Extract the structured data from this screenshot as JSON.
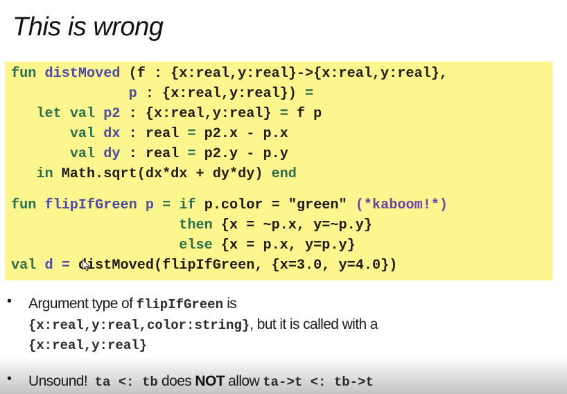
{
  "slide": {
    "title": "This is wrong"
  },
  "code": {
    "l1": {
      "fun": "fun",
      "name": "distMoved",
      "rest": " (f : {x:real,y:real}->{x:real,y:real},"
    },
    "l2": {
      "indent": "              ",
      "p": "p",
      "rest": " : {x:real,y:real}) ",
      "eq": "="
    },
    "l3": {
      "indent": "   ",
      "let": "let",
      "sp": " ",
      "val": "val",
      "sp2": " ",
      "p2": "p2",
      "rest": " : {x:real,y:real} ",
      "eq": "=",
      "tail": " f p"
    },
    "l4": {
      "indent": "       ",
      "val": "val",
      "sp": " ",
      "dx": "dx",
      "rest": " : real ",
      "eq": "=",
      "tail": " p2.x - p.x"
    },
    "l5": {
      "indent": "       ",
      "val": "val",
      "sp": " ",
      "dy": "dy",
      "rest": " : real ",
      "eq": "=",
      "tail": " p2.y - p.y"
    },
    "l6": {
      "indent": "   ",
      "in": "in",
      "rest": " Math.sqrt(dx*dx + dy*dy) ",
      "end": "end"
    },
    "l7": {
      "fun": "fun",
      "sp": " ",
      "name": "flipIfGreen",
      "sp2": " ",
      "p": "p",
      "sp3": " ",
      "eq": "=",
      "sp4": " ",
      "if": "if",
      "rest": " p.color = \"green\" ",
      "comment": "(*kaboom!*)"
    },
    "l8": {
      "indent": "                    ",
      "then": "then",
      "rest": " {x = ~p.x, y=~p.y}"
    },
    "l9": {
      "indent": "                    ",
      "else": "else",
      "rest": " {x = p.x, y=p.y}"
    },
    "l10": {
      "val": "val",
      "sp": " ",
      "d": "d",
      "sp2": " ",
      "eq": "=",
      "rest": " distMoved(flipIfGreen, {x=3.0, y=4.0})"
    }
  },
  "bullets": {
    "b1": {
      "dot": "•",
      "line1_text": "Argument type of ",
      "line1_code": "flipIfGreen",
      "line1_tail": " is",
      "line2_code": "{x:real,y:real,color:string}",
      "line2_tail": ", but it is called with a",
      "line3_code": "{x:real,y:real}"
    },
    "b2": {
      "dot": "•",
      "lead": "Unsound!  ",
      "code1": "ta <: tb",
      "mid": " does ",
      "strong": "NOT",
      "mid2": " allow ",
      "code2": "ta->t <: tb->t"
    }
  },
  "colors": {
    "code_background": "#fdf58d",
    "keyword": "#2d6e4f",
    "identifier": "#4a4aa8",
    "comment": "#6a44a8",
    "text": "#1f1a10"
  }
}
